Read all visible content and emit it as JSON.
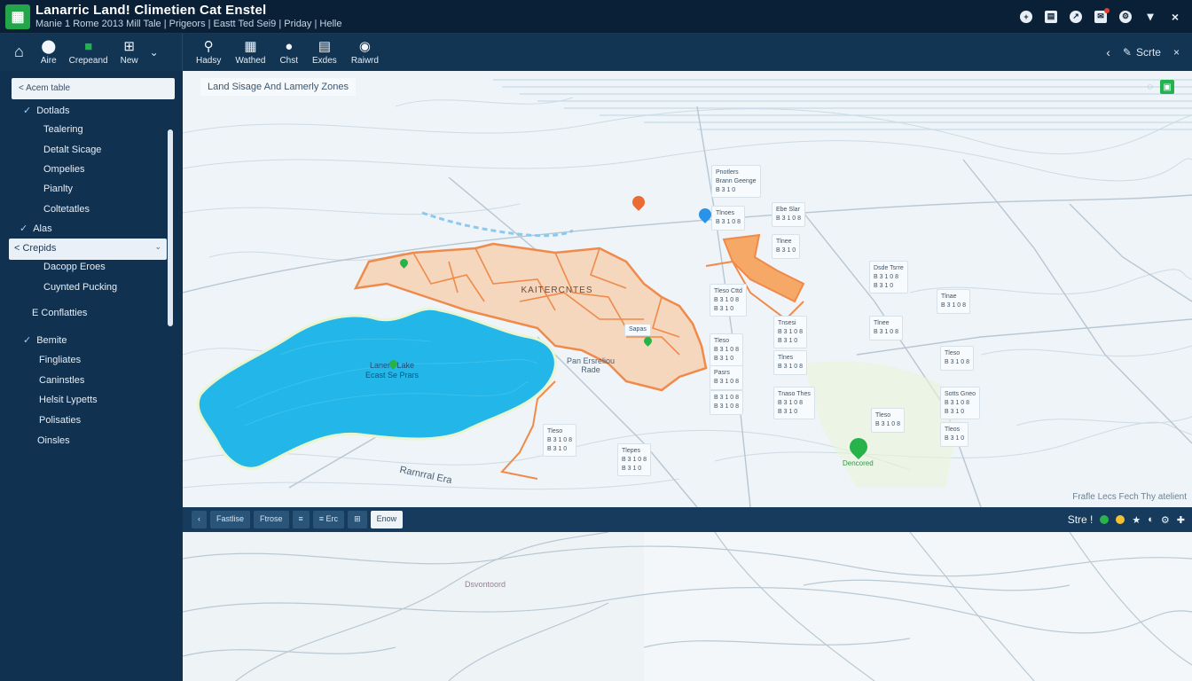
{
  "titlebar": {
    "title": "Lanarric Land! Climetien Cat Enstel",
    "subtitle": "Manie 1 Rome 2013 Mill Tale | Prigeors | Eastt Ted Sei9 | Priday | Helle",
    "controls": [
      "plus-circle-icon",
      "stack-icon",
      "share-icon",
      "notification-icon",
      "settings-icon",
      "chevron-down-icon",
      "close-icon"
    ]
  },
  "toolbar": {
    "left": [
      {
        "label": "",
        "icon": "home-icon"
      },
      {
        "label": "Aire",
        "icon": "pin-icon"
      },
      {
        "label": "Crepeand",
        "icon": "green-square-icon"
      },
      {
        "label": "New",
        "icon": "grid-icon"
      }
    ],
    "mid": [
      {
        "label": "Hadsy",
        "icon": "search-layers-icon"
      },
      {
        "label": "Wathed",
        "icon": "table-icon"
      },
      {
        "label": "Chst",
        "icon": "chat-icon"
      },
      {
        "label": "Exdes",
        "icon": "spreadsheet-icon"
      },
      {
        "label": "Raiwrd",
        "icon": "globe-icon"
      }
    ],
    "right": {
      "back": "‹",
      "edit_label": "Scrte",
      "close": "×"
    }
  },
  "sidebar": {
    "search_placeholder": "< Acem table",
    "items": [
      {
        "label": "Dotlads",
        "check": true,
        "indent": 0
      },
      {
        "label": "Tealering",
        "indent": 1
      },
      {
        "label": "Detalt Sicage",
        "indent": 1
      },
      {
        "label": "Ompelies",
        "indent": 1
      },
      {
        "label": "Pianlty",
        "indent": 1
      },
      {
        "label": "Coltetatles",
        "indent": 1
      },
      {
        "label": "Alas",
        "check": true,
        "indent": 0
      },
      {
        "label": "< Crepids",
        "selected": true
      },
      {
        "label": "Dacopp Eroes",
        "indent": 1
      },
      {
        "label": "Cuynted Pucking",
        "indent": 1
      },
      {
        "label": "E Conflatties",
        "indent": 0
      },
      {
        "label": "Bemite",
        "check": true,
        "indent": 0
      },
      {
        "label": "Fingliates",
        "indent": 1
      },
      {
        "label": "Caninstles",
        "indent": 1
      },
      {
        "label": "Helsit Lypetts",
        "indent": 1
      },
      {
        "label": "Polisaties",
        "indent": 1
      },
      {
        "label": "Oinsles",
        "indent": 1
      }
    ]
  },
  "map": {
    "title": "Land Sisage And Lamerly Zones",
    "water_label": "Lanerd Lake\nEcast Se Prars",
    "zone_label": "KAITERCNTES",
    "road_label": "Pan Ersreliou\nRade",
    "river_label": "Rarnrral Era",
    "pin_label": "Dencored",
    "small_label": "Sapas",
    "caption": "Frafle Lecs Fech Thy atelient",
    "cards": [
      "Pnotlers\nBrann Geenge\nB 3 1 0",
      "Tlnoes\nB 3 1 0 8",
      "Ebe Slar\nB 3 1 0 8",
      "Tlnee\nB 3 1 0",
      "Dsde Tsrre\nB 3 1 0 8\nB 3 1 0",
      "Tleso Cttd\nB 3 1 0 8\nB 3 1 0",
      "Tlnae\nB 3 1 0 8",
      "Tnsesi\nB 3 1 0 8\nB 3 1 0",
      "Tlnee\nB 3 1 0 8",
      "Tleso\nB 3 1 0 8\nB 3 1 0",
      "Tleso\nB 3 1 0 8",
      "Tlnes\nB 3 1 0 8",
      "Pasrs\nB 3 1 0 8",
      "B 3 1 0 8\nB 3 1 0 8",
      "Tnaso Thes\nB 3 1 0 8\nB 3 1 0",
      "Sotts Gneo\nB 3 1 0 8\nB 3 1 0",
      "Tleso\nB 3 1 0 8\nB 3 1 0",
      "Tlepes\nB 3 1 0 8\nB 3 1 0",
      "Tleso\nB 3 1 0 8",
      "Tleos\nB 3 1 0"
    ]
  },
  "bottombar": {
    "buttons": [
      "‹",
      "Fastlise",
      "Ftrose",
      "≡",
      "≡ Erc",
      "⊞",
      "Enow"
    ],
    "right_label": "Stre !",
    "colors": {
      "green": "#2bb24c",
      "yellow": "#f2c230"
    }
  },
  "bottom_map": {
    "label": "Dsvontoord"
  },
  "colors": {
    "accent": "#23a64a",
    "water": "#22b7e8",
    "zone_orange": "#f08a4b",
    "zone_fill": "#f5d7bd",
    "pin_orange": "#ec6b34",
    "pin_blue": "#2893e8",
    "pin_green": "#27b24a"
  }
}
